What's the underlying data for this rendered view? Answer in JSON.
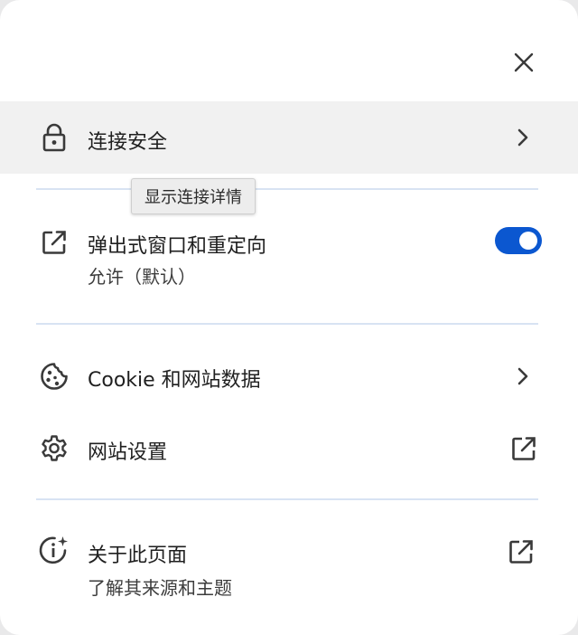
{
  "colors": {
    "toggle_on": "#0b57d0",
    "divider": "#d8e3f3",
    "highlight": "#f1f1f1"
  },
  "connection": {
    "title": "连接安全",
    "icon": "lock-icon",
    "tooltip": "显示连接详情"
  },
  "popups": {
    "title": "弹出式窗口和重定向",
    "subtitle": "允许（默认）",
    "icon": "open-in-new-icon",
    "toggle_on": true
  },
  "cookies": {
    "title": "Cookie 和网站数据",
    "icon": "cookie-icon"
  },
  "site_settings": {
    "title": "网站设置",
    "icon": "gear-icon"
  },
  "about_page": {
    "title": "关于此页面",
    "subtitle": "了解其来源和主题",
    "icon": "info-sparkle-icon"
  }
}
